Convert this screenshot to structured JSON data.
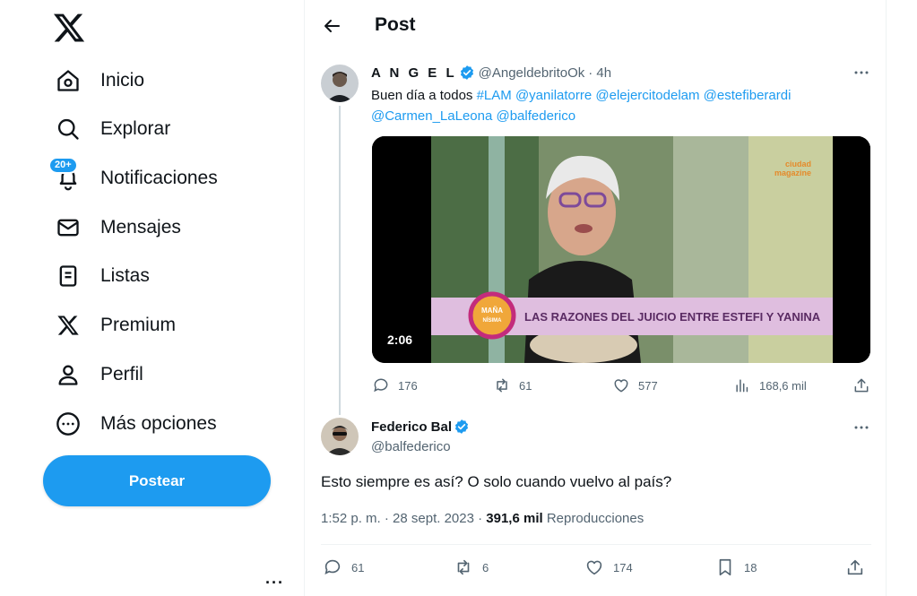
{
  "nav": {
    "items": [
      {
        "label": "Inicio",
        "icon": "home-icon"
      },
      {
        "label": "Explorar",
        "icon": "search-icon"
      },
      {
        "label": "Notificaciones",
        "icon": "bell-icon",
        "badge": "20+"
      },
      {
        "label": "Mensajes",
        "icon": "envelope-icon"
      },
      {
        "label": "Listas",
        "icon": "list-icon"
      },
      {
        "label": "Premium",
        "icon": "x-logo-icon"
      },
      {
        "label": "Perfil",
        "icon": "person-icon"
      },
      {
        "label": "Más opciones",
        "icon": "more-circle-icon"
      }
    ],
    "post_button": "Postear",
    "more_dots": "···"
  },
  "header": {
    "title": "Post"
  },
  "quoted": {
    "name": "A N G E L",
    "handle": "@AngeldebritoOk",
    "time": "· 4h",
    "text_prefix": "Buen día a todos ",
    "links_line1": "#LAM @yanilatorre @elejercitodelam @estefiberardi",
    "links_line2": "@Carmen_LaLeona @balfederico",
    "video": {
      "duration": "2:06",
      "banner": "LAS RAZONES DEL JUICIO ENTRE ESTEFI Y YANINA",
      "show_logo": "MAÑA NÍSIMA",
      "channel": "ciudad magazine"
    },
    "stats": {
      "replies": "176",
      "reposts": "61",
      "likes": "577",
      "views": "168,6 mil"
    }
  },
  "reply": {
    "name": "Federico Bal",
    "handle": "@balfederico",
    "text": "Esto siempre es así? O solo cuando vuelvo al país?",
    "meta_time": "1:52 p. m. · 28 sept. 2023 · ",
    "views_count": "391,6 mil",
    "views_label": " Reproducciones",
    "stats": {
      "replies": "61",
      "reposts": "6",
      "likes": "174",
      "bookmarks": "18"
    }
  },
  "colors": {
    "accent": "#1d9bf0",
    "text": "#0f1419",
    "muted": "#536471",
    "border": "#eff3f4"
  }
}
